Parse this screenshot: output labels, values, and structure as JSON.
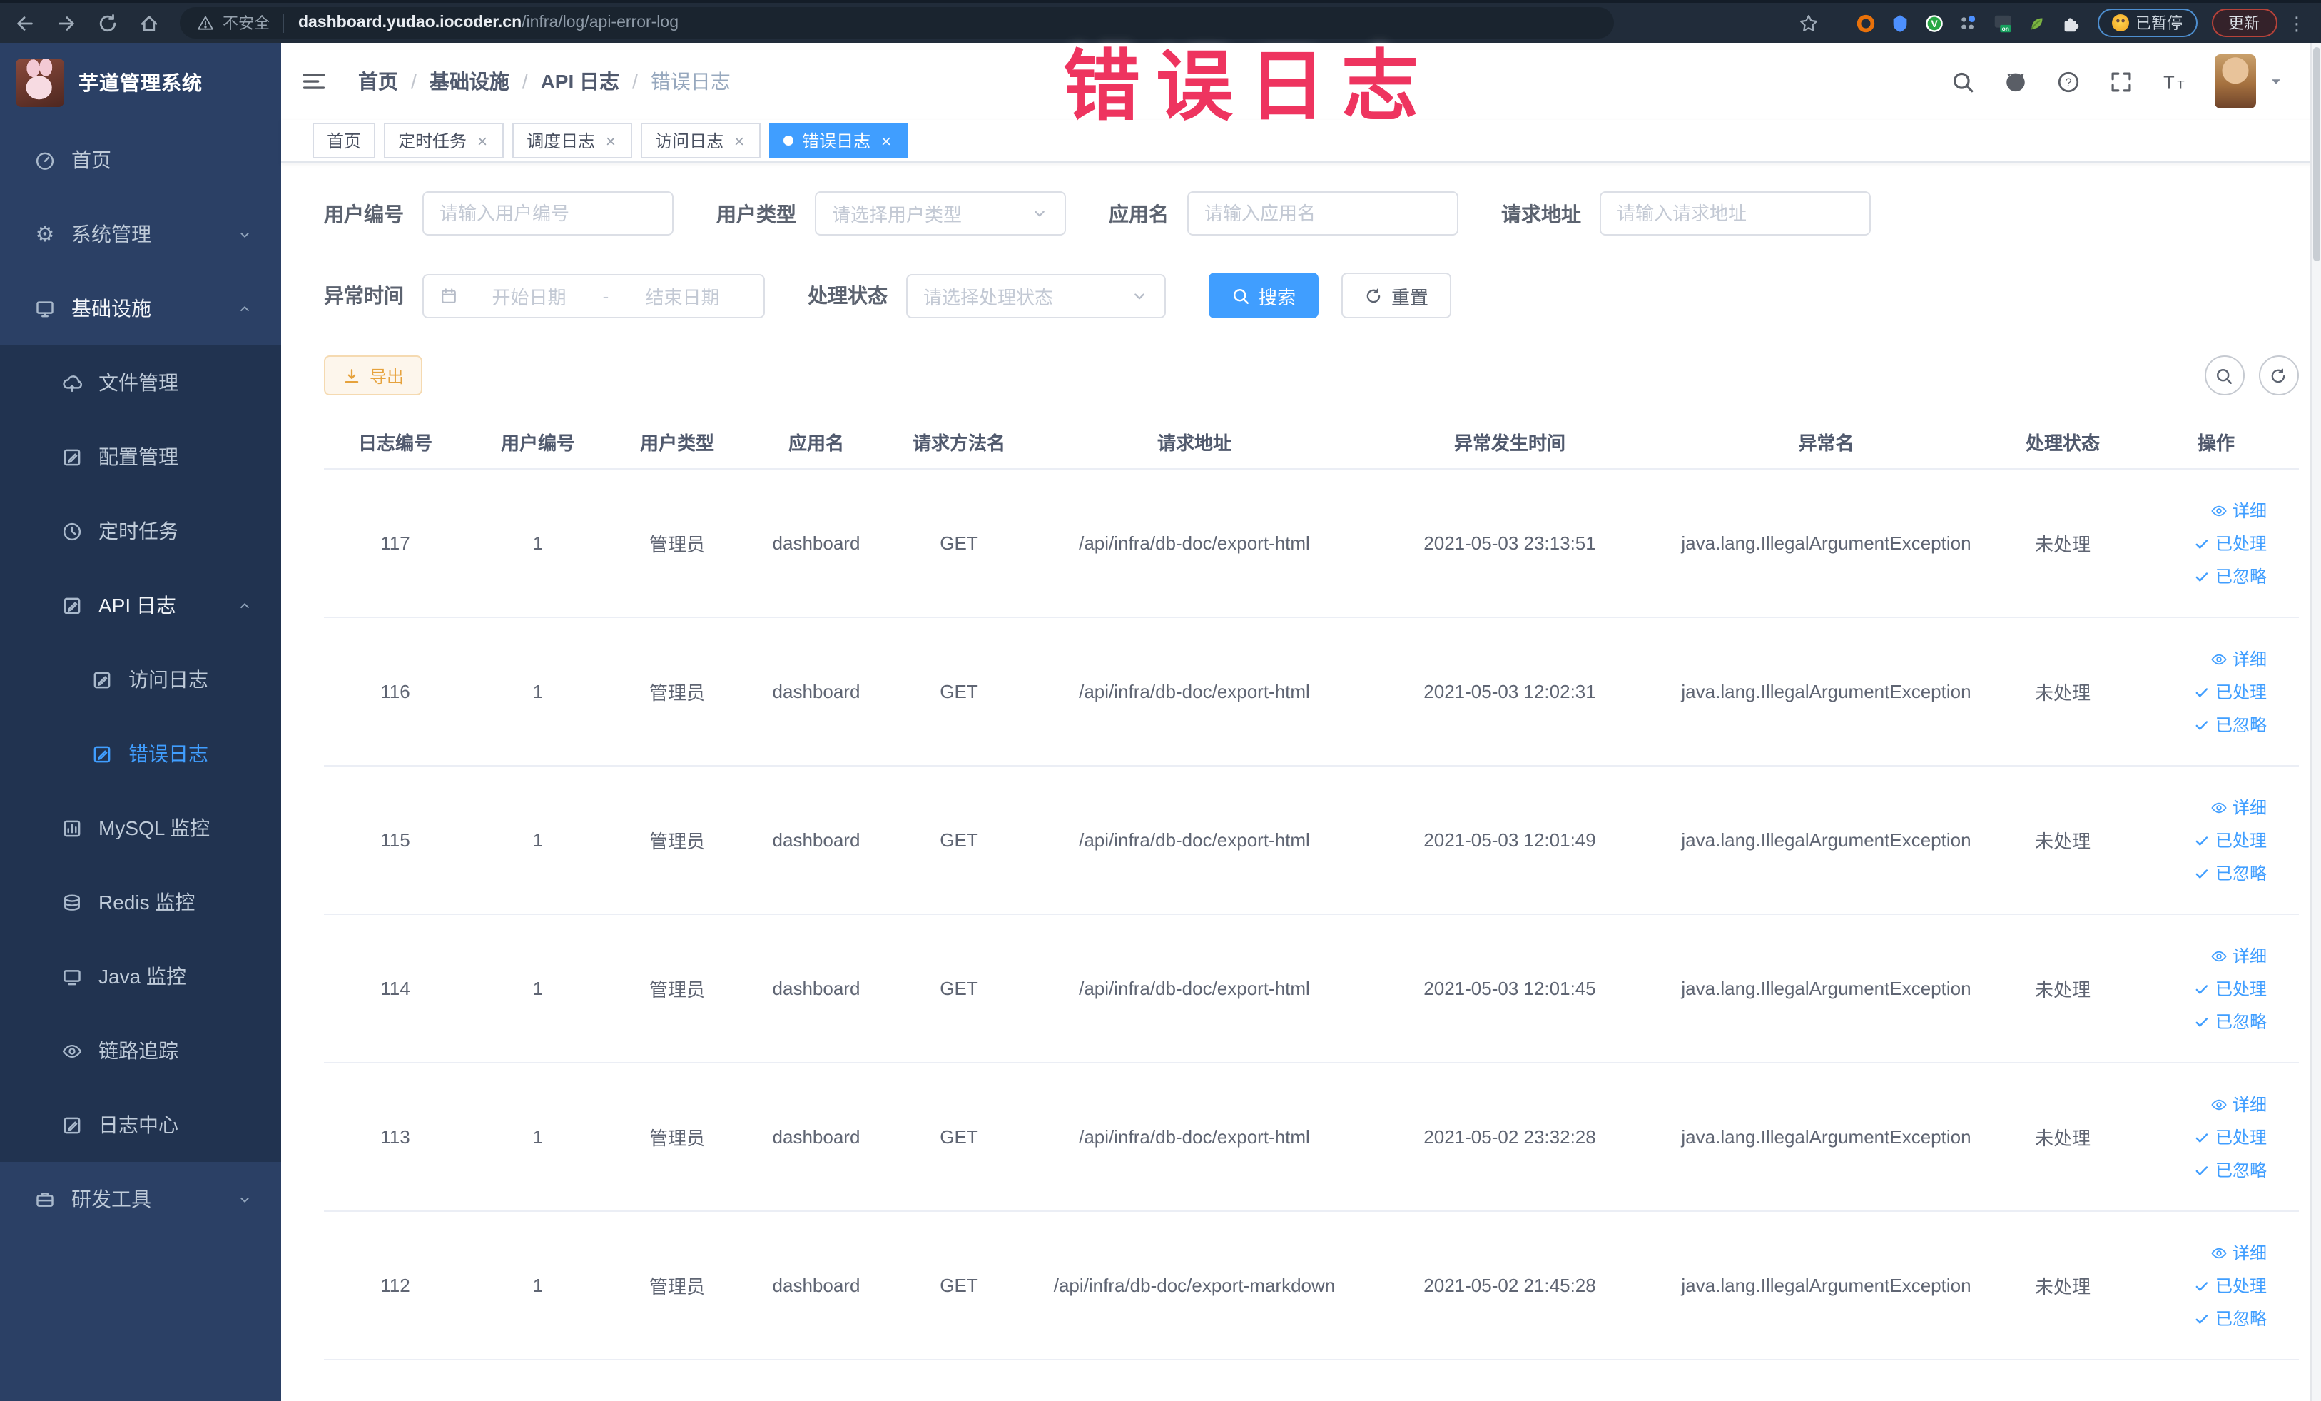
{
  "browser": {
    "security_label": "不安全",
    "url_domain": "dashboard.yudao.iocoder.cn",
    "url_path": "/infra/log/api-error-log",
    "paused_badge_label": "已暂停",
    "update_button_label": "更新",
    "extensions": [
      {
        "name": "extension-orange",
        "icon": "orangering"
      },
      {
        "name": "extension-blue-shield",
        "icon": "shield"
      },
      {
        "name": "extension-green-v",
        "icon": "greenv"
      },
      {
        "name": "extension-grid",
        "icon": "gridext"
      },
      {
        "name": "extension-on-switch",
        "icon": "onext"
      },
      {
        "name": "extension-leaf",
        "icon": "leaf"
      },
      {
        "name": "extensions-puzzle",
        "icon": "puzzle"
      }
    ]
  },
  "annotation": {
    "text": "错误日志",
    "color": "#ee345f"
  },
  "sidebar": {
    "title": "芋道管理系统",
    "menu": [
      {
        "key": "home",
        "label": "首页",
        "icon": "gauge",
        "level": 1
      },
      {
        "key": "system",
        "label": "系统管理",
        "icon": "gear",
        "level": 1,
        "chevron": "down"
      },
      {
        "key": "infra",
        "label": "基础设施",
        "icon": "monitor",
        "level": 1,
        "chevron": "up",
        "active_path": true
      },
      {
        "key": "file",
        "label": "文件管理",
        "icon": "cloud",
        "level": 2,
        "sub": true
      },
      {
        "key": "config",
        "label": "配置管理",
        "icon": "edit",
        "level": 2,
        "sub": true
      },
      {
        "key": "job",
        "label": "定时任务",
        "icon": "clock",
        "level": 2,
        "sub": true
      },
      {
        "key": "api-log",
        "label": "API 日志",
        "icon": "edit",
        "level": 2,
        "sub": true,
        "chevron": "up",
        "active_path": true
      },
      {
        "key": "access-log",
        "label": "访问日志",
        "icon": "edit",
        "level": 3,
        "sub": true
      },
      {
        "key": "error-log",
        "label": "错误日志",
        "icon": "edit",
        "level": 3,
        "sub": true,
        "active": true
      },
      {
        "key": "mysql",
        "label": "MySQL 监控",
        "icon": "chart",
        "level": 2,
        "sub": true
      },
      {
        "key": "redis",
        "label": "Redis 监控",
        "icon": "stack",
        "level": 2,
        "sub": true
      },
      {
        "key": "java",
        "label": "Java 监控",
        "icon": "screen",
        "level": 2,
        "sub": true
      },
      {
        "key": "tracing",
        "label": "链路追踪",
        "icon": "eye",
        "level": 2,
        "sub": true
      },
      {
        "key": "log-center",
        "label": "日志中心",
        "icon": "edit",
        "level": 2,
        "sub": true
      },
      {
        "key": "dev-tools",
        "label": "研发工具",
        "icon": "toolbox",
        "level": 1,
        "chevron": "down"
      }
    ]
  },
  "header": {
    "breadcrumb": [
      "首页",
      "基础设施",
      "API 日志",
      "错误日志"
    ]
  },
  "tabs": [
    {
      "key": "home",
      "label": "首页",
      "closable": false,
      "active": false
    },
    {
      "key": "job",
      "label": "定时任务",
      "closable": true,
      "active": false
    },
    {
      "key": "job-log",
      "label": "调度日志",
      "closable": true,
      "active": false
    },
    {
      "key": "access-log",
      "label": "访问日志",
      "closable": true,
      "active": false
    },
    {
      "key": "error-log",
      "label": "错误日志",
      "closable": true,
      "active": true
    }
  ],
  "filters": {
    "user_id": {
      "label": "用户编号",
      "placeholder": "请输入用户编号"
    },
    "user_type": {
      "label": "用户类型",
      "placeholder": "请选择用户类型"
    },
    "app_name": {
      "label": "应用名",
      "placeholder": "请输入应用名"
    },
    "request_url": {
      "label": "请求地址",
      "placeholder": "请输入请求地址"
    },
    "exception_time": {
      "label": "异常时间",
      "start_placeholder": "开始日期",
      "separator": "-",
      "end_placeholder": "结束日期"
    },
    "process_status": {
      "label": "处理状态",
      "placeholder": "请选择处理状态"
    },
    "search_label": "搜索",
    "reset_label": "重置"
  },
  "toolbar": {
    "export_label": "导出"
  },
  "table": {
    "columns": [
      "日志编号",
      "用户编号",
      "用户类型",
      "应用名",
      "请求方法名",
      "请求地址",
      "异常发生时间",
      "异常名",
      "处理状态",
      "操作"
    ],
    "actions": [
      "详细",
      "已处理",
      "已忽略"
    ],
    "rows": [
      {
        "id": "117",
        "user_id": "1",
        "user_type": "管理员",
        "app": "dashboard",
        "method": "GET",
        "url": "/api/infra/db-doc/export-html",
        "time": "2021-05-03 23:13:51",
        "exception": "java.lang.IllegalArgumentException",
        "status": "未处理"
      },
      {
        "id": "116",
        "user_id": "1",
        "user_type": "管理员",
        "app": "dashboard",
        "method": "GET",
        "url": "/api/infra/db-doc/export-html",
        "time": "2021-05-03 12:02:31",
        "exception": "java.lang.IllegalArgumentException",
        "status": "未处理"
      },
      {
        "id": "115",
        "user_id": "1",
        "user_type": "管理员",
        "app": "dashboard",
        "method": "GET",
        "url": "/api/infra/db-doc/export-html",
        "time": "2021-05-03 12:01:49",
        "exception": "java.lang.IllegalArgumentException",
        "status": "未处理"
      },
      {
        "id": "114",
        "user_id": "1",
        "user_type": "管理员",
        "app": "dashboard",
        "method": "GET",
        "url": "/api/infra/db-doc/export-html",
        "time": "2021-05-03 12:01:45",
        "exception": "java.lang.IllegalArgumentException",
        "status": "未处理"
      },
      {
        "id": "113",
        "user_id": "1",
        "user_type": "管理员",
        "app": "dashboard",
        "method": "GET",
        "url": "/api/infra/db-doc/export-html",
        "time": "2021-05-02 23:32:28",
        "exception": "java.lang.IllegalArgumentException",
        "status": "未处理"
      },
      {
        "id": "112",
        "user_id": "1",
        "user_type": "管理员",
        "app": "dashboard",
        "method": "GET",
        "url": "/api/infra/db-doc/export-markdown",
        "time": "2021-05-02 21:45:28",
        "exception": "java.lang.IllegalArgumentException",
        "status": "未处理"
      }
    ]
  },
  "colors": {
    "accent": "#409eff",
    "sidebar_bg": "#2b4065",
    "sidebar_submenu_bg": "#213350",
    "annotation": "#ee345f",
    "export_button_text": "#e6a23c"
  }
}
